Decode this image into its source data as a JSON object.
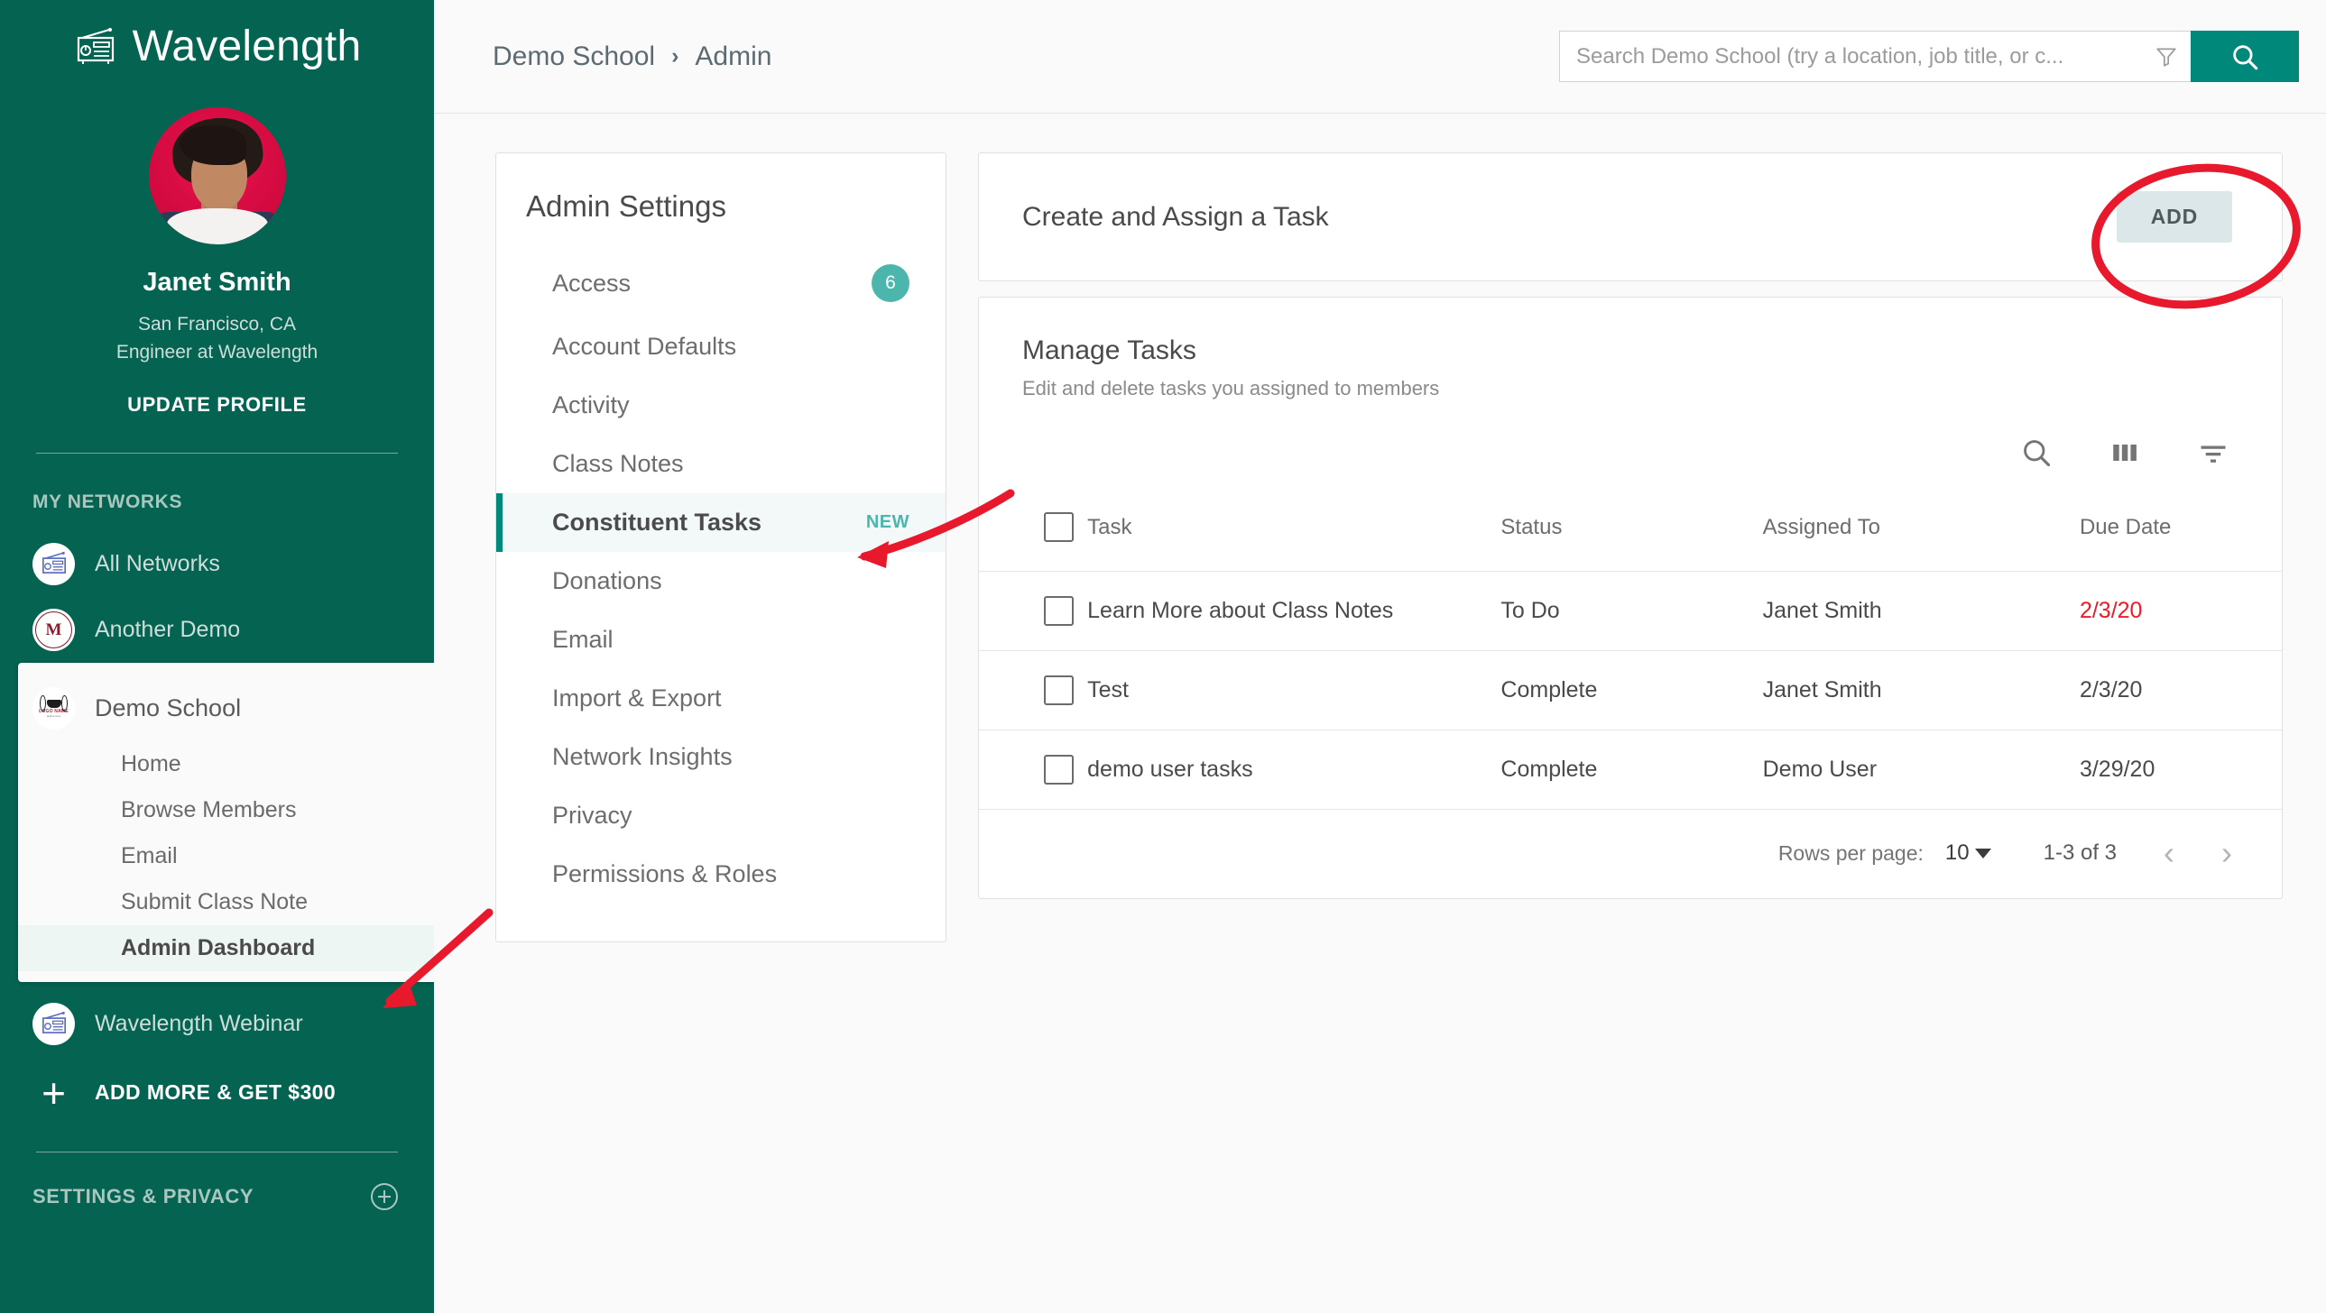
{
  "sidebar": {
    "brand": {
      "name": "Wavelength",
      "logo_icon": "radio-icon"
    },
    "profile": {
      "name": "Janet Smith",
      "location": "San Francisco, CA",
      "title": "Engineer at Wavelength",
      "update_label": "UPDATE PROFILE"
    },
    "networks_label": "MY NETWORKS",
    "networks": [
      {
        "label": "All Networks",
        "icon": "radio-icon"
      },
      {
        "label": "Another Demo",
        "icon": "vmi-crest-icon"
      }
    ],
    "active_network": {
      "label": "Demo School",
      "icon": "school-logo-icon",
      "items": [
        {
          "label": "Home",
          "active": false
        },
        {
          "label": "Browse Members",
          "active": false
        },
        {
          "label": "Email",
          "active": false
        },
        {
          "label": "Submit Class Note",
          "active": false
        },
        {
          "label": "Admin Dashboard",
          "active": true
        }
      ]
    },
    "networks_after": [
      {
        "label": "Wavelength Webinar",
        "icon": "radio-icon"
      }
    ],
    "add_more": {
      "label": "ADD MORE & GET $300",
      "icon": "plus-icon"
    },
    "settings_privacy": {
      "label": "SETTINGS & PRIVACY",
      "icon": "plus-circle-icon"
    }
  },
  "topbar": {
    "breadcrumb": [
      "Demo School",
      "Admin"
    ],
    "separator": "›",
    "search": {
      "value": "",
      "placeholder": "Search Demo School (try a location, job title, or c...",
      "filter_icon": "funnel-icon",
      "search_icon": "search-icon"
    }
  },
  "settings_panel": {
    "title": "Admin Settings",
    "items": [
      {
        "label": "Access",
        "badge": "6",
        "badge_type": "count",
        "active": false
      },
      {
        "label": "Account Defaults",
        "badge": "",
        "badge_type": "",
        "active": false
      },
      {
        "label": "Activity",
        "badge": "",
        "badge_type": "",
        "active": false
      },
      {
        "label": "Class Notes",
        "badge": "",
        "badge_type": "",
        "active": false
      },
      {
        "label": "Constituent Tasks",
        "badge": "NEW",
        "badge_type": "new",
        "active": true
      },
      {
        "label": "Donations",
        "badge": "",
        "badge_type": "",
        "active": false
      },
      {
        "label": "Email",
        "badge": "",
        "badge_type": "",
        "active": false
      },
      {
        "label": "Import & Export",
        "badge": "",
        "badge_type": "",
        "active": false
      },
      {
        "label": "Network Insights",
        "badge": "",
        "badge_type": "",
        "active": false
      },
      {
        "label": "Privacy",
        "badge": "",
        "badge_type": "",
        "active": false
      },
      {
        "label": "Permissions & Roles",
        "badge": "",
        "badge_type": "",
        "active": false
      }
    ]
  },
  "create_task_card": {
    "title": "Create and Assign a Task",
    "add_label": "ADD"
  },
  "manage_tasks": {
    "title": "Manage Tasks",
    "subtitle": "Edit and delete tasks you assigned to members",
    "tools": [
      "search-icon",
      "columns-icon",
      "filter-icon"
    ],
    "columns": [
      "Task",
      "Status",
      "Assigned To",
      "Due Date"
    ],
    "rows": [
      {
        "task": "Learn More about Class Notes",
        "status": "To Do",
        "assigned_to": "Janet Smith",
        "due_date": "2/3/20",
        "overdue": true
      },
      {
        "task": "Test",
        "status": "Complete",
        "assigned_to": "Janet Smith",
        "due_date": "2/3/20",
        "overdue": false
      },
      {
        "task": "demo user tasks",
        "status": "Complete",
        "assigned_to": "Demo User",
        "due_date": "3/29/20",
        "overdue": false
      }
    ],
    "pagination": {
      "rows_per_page_label": "Rows per page:",
      "rows_per_page_value": "10",
      "range": "1-3 of 3",
      "prev_icon": "chevron-left-icon",
      "next_icon": "chevron-right-icon"
    }
  },
  "colors": {
    "sidebar_bg": "#046351",
    "accent_teal": "#00897b",
    "badge_teal": "#4db6ac",
    "overdue_red": "#ee1b24",
    "annotation_red": "#e8192c",
    "add_button_bg": "#dbe7e9"
  }
}
